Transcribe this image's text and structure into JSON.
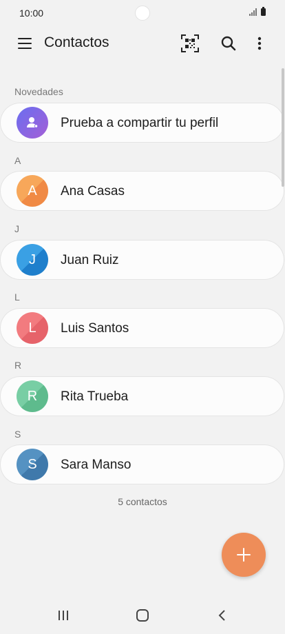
{
  "status_bar": {
    "time": "10:00"
  },
  "app_bar": {
    "title": "Contactos"
  },
  "sections": [
    {
      "header": "Novedades",
      "contacts": [
        {
          "name": "Prueba a compartir tu perfil",
          "initial": "",
          "icon": "person-share-icon",
          "color": "#8f6bea"
        }
      ]
    },
    {
      "header": "A",
      "contacts": [
        {
          "name": "Ana Casas",
          "initial": "A",
          "color": "#f59a4f"
        }
      ]
    },
    {
      "header": "J",
      "contacts": [
        {
          "name": "Juan Ruiz",
          "initial": "J",
          "color": "#2d8fd8"
        }
      ]
    },
    {
      "header": "L",
      "contacts": [
        {
          "name": "Luis Santos",
          "initial": "L",
          "color": "#ec6e73"
        }
      ]
    },
    {
      "header": "R",
      "contacts": [
        {
          "name": "Rita Trueba",
          "initial": "R",
          "color": "#6cc49a"
        }
      ]
    },
    {
      "header": "S",
      "contacts": [
        {
          "name": "Sara Manso",
          "initial": "S",
          "color": "#4a86b8"
        }
      ]
    }
  ],
  "footer": {
    "count": "5 contactos"
  },
  "colors": {
    "fab": "#ee8d59",
    "background": "#f2f2f2"
  }
}
